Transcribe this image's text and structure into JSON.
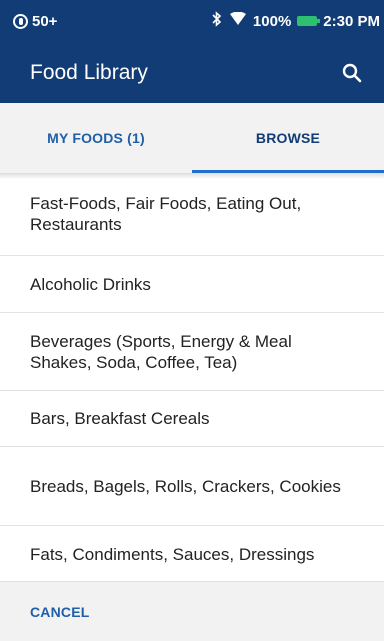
{
  "status_bar": {
    "notification_count": "50+",
    "battery": "100%",
    "time": "2:30 PM"
  },
  "app_bar": {
    "title": "Food Library",
    "search_icon": "search-icon"
  },
  "tabs": [
    {
      "label": "MY FOODS (1)",
      "active": false
    },
    {
      "label": "BROWSE",
      "active": true
    }
  ],
  "categories": [
    "Fast-Foods, Fair Foods, Eating Out, Restaurants",
    "Alcoholic Drinks",
    "Beverages (Sports, Energy & Meal Shakes, Soda, Coffee, Tea)",
    "Bars, Breakfast Cereals",
    "Breads, Bagels, Rolls, Crackers, Cookies",
    "Fats, Condiments, Sauces, Dressings"
  ],
  "footer": {
    "cancel_label": "CANCEL"
  },
  "colors": {
    "header_bg": "#123c75",
    "accent": "#1f6fc9",
    "tab_bg": "#f2f2f2",
    "battery": "#2fbf71"
  }
}
